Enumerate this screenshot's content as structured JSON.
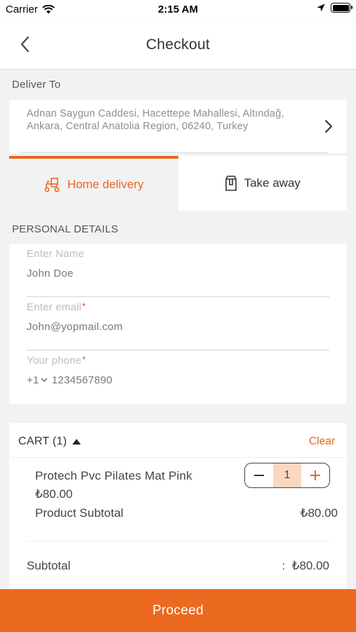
{
  "status_bar": {
    "carrier": "Carrier",
    "time": "2:15 AM"
  },
  "header": {
    "title": "Checkout"
  },
  "deliver_to": {
    "label": "Deliver To",
    "address": "Adnan Saygun Caddesi, Hacettepe Mahallesi, Altındağ, Ankara, Central Anatolia Region, 06240, Turkey"
  },
  "delivery_options": [
    {
      "label": "Home delivery",
      "selected": true
    },
    {
      "label": "Take away",
      "selected": false
    }
  ],
  "personal_details": {
    "heading": "PERSONAL DETAILS",
    "name": {
      "label": "Enter Name",
      "value": "John Doe"
    },
    "email": {
      "label": "Enter email",
      "required_mark": "*",
      "value": "John@yopmail.com"
    },
    "phone": {
      "label": "Your phone",
      "required_mark": "*",
      "country_code": "+1",
      "value": "1234567890"
    }
  },
  "cart": {
    "title": "CART (1)",
    "clear_label": "Clear",
    "items": [
      {
        "name": "Protech Pvc Pilates Mat Pink",
        "price": "₺80.00",
        "quantity": "1",
        "subtotal_label": "Product Subtotal",
        "subtotal_value": "₺80.00"
      }
    ],
    "subtotal_label": "Subtotal",
    "subtotal_value": ":  ₺80.00"
  },
  "actions": {
    "proceed_label": "Proceed"
  },
  "colors": {
    "accent": "#ec6a1f",
    "background": "#f2f2f2",
    "quantity_bg": "#fbd7bf"
  }
}
